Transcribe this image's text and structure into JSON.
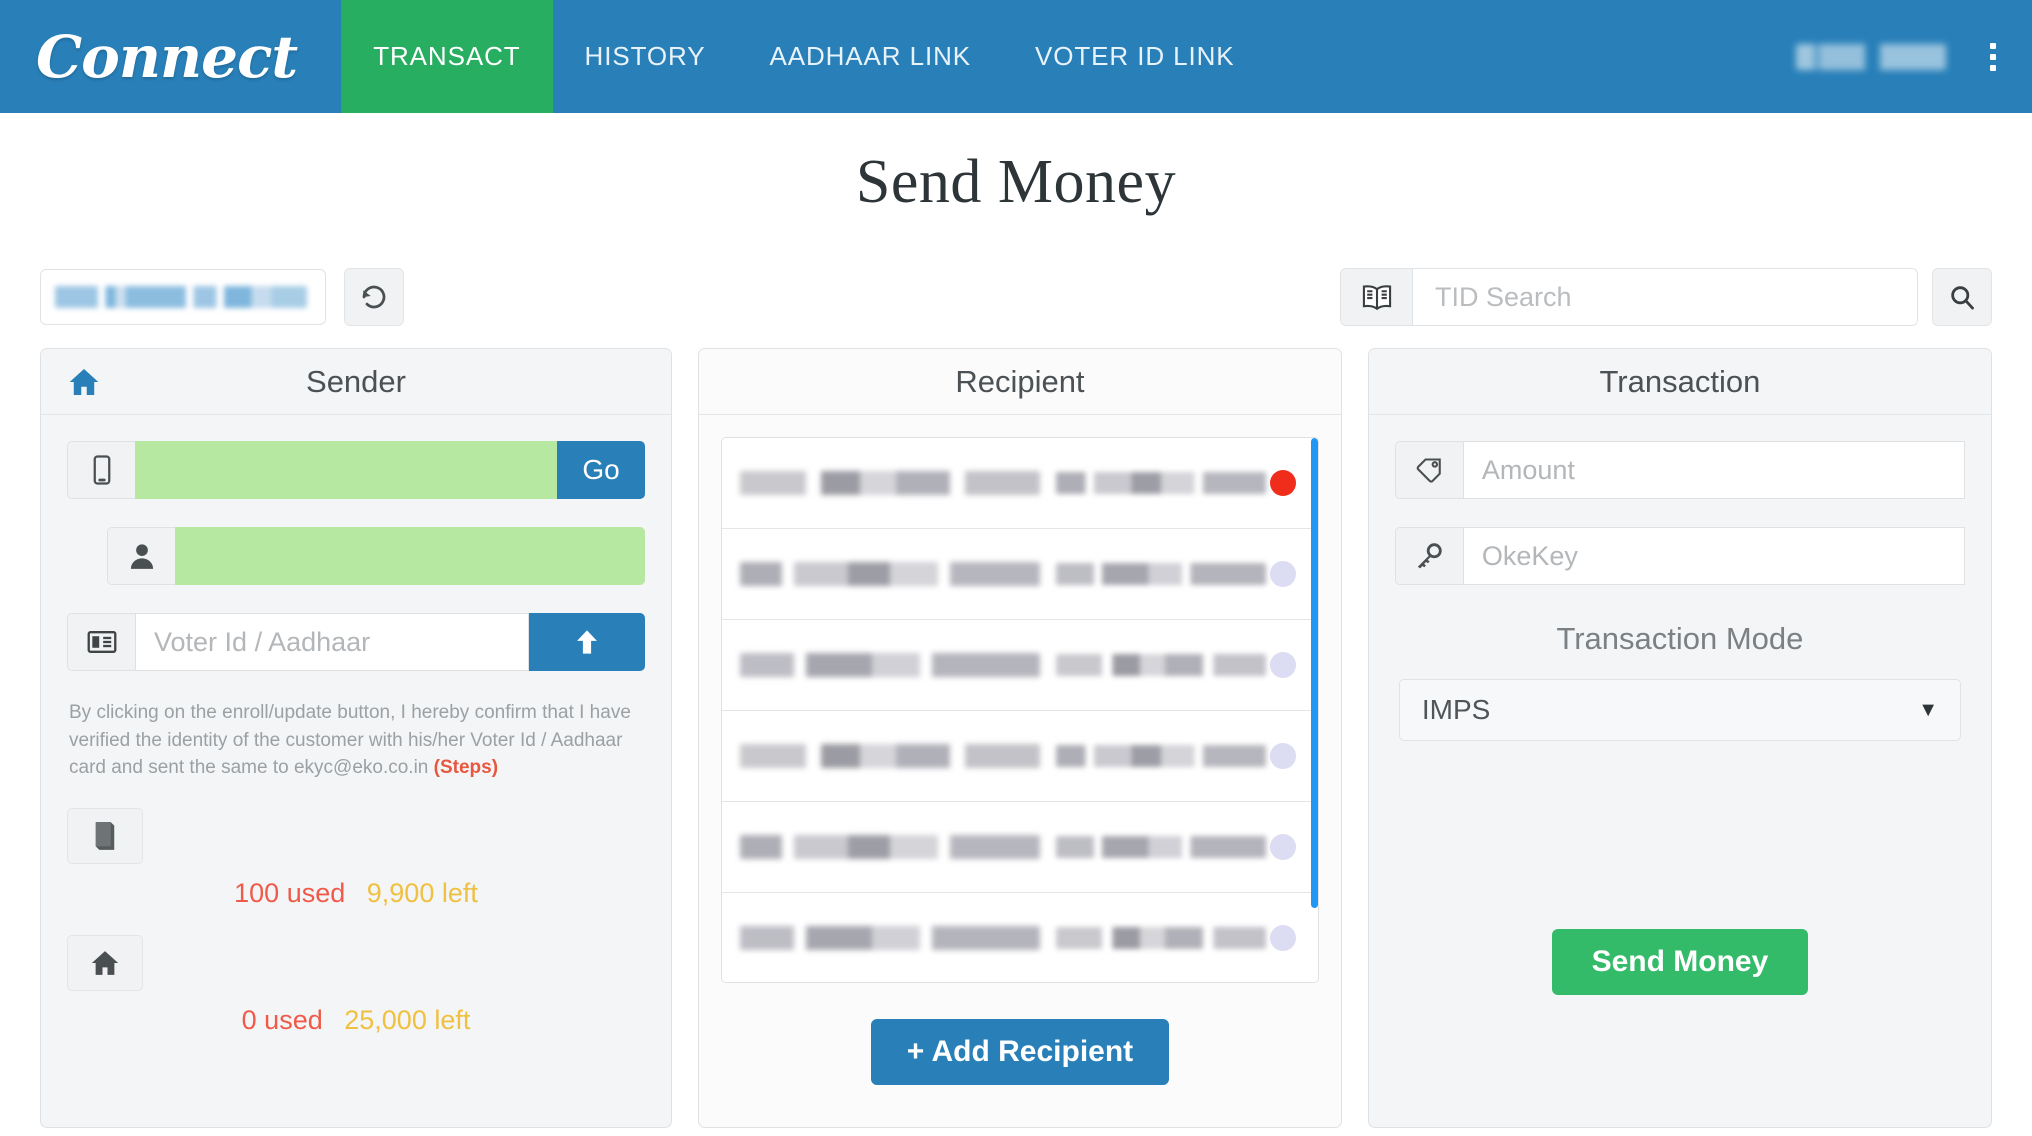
{
  "navbar": {
    "brand": "Connect",
    "tabs": [
      {
        "label": "TRANSACT",
        "active": true
      },
      {
        "label": "HISTORY",
        "active": false
      },
      {
        "label": "AADHAAR LINK",
        "active": false
      },
      {
        "label": "VOTER ID LINK",
        "active": false
      }
    ],
    "user_redacted": "",
    "menu_icon": "kebab-menu-icon",
    "colors": {
      "bar": "#2980b9",
      "active_tab": "#27ae60"
    }
  },
  "page": {
    "title": "Send Money"
  },
  "toolbar": {
    "agent_field_redacted": "",
    "refresh_icon": "refresh-icon",
    "search": {
      "book_icon": "book-icon",
      "placeholder": "TID Search",
      "value": "",
      "search_icon": "search-icon"
    }
  },
  "sender": {
    "title": "Sender",
    "home_icon": "home-icon",
    "mobile": {
      "icon": "mobile-icon",
      "value_redacted": "",
      "go_label": "Go"
    },
    "name": {
      "icon": "person-icon",
      "value_redacted": ""
    },
    "voter": {
      "icon": "id-card-icon",
      "placeholder": "Voter Id / Aadhaar",
      "value": "",
      "upload_icon": "upload-arrow-icon"
    },
    "disclaimer": "By clicking on the enroll/update button, I hereby confirm that I have verified the identity of the customer with his/her Voter Id / Aadhaar card and sent the same to ekyc@eko.co.in",
    "disclaimer_link": "(Steps)",
    "limits": [
      {
        "icon": "book-icon",
        "used": "100 used",
        "left": "9,900 left"
      },
      {
        "icon": "home-icon",
        "used": "0 used",
        "left": "25,000 left"
      }
    ]
  },
  "recipient": {
    "title": "Recipient",
    "rows": [
      {
        "name_redacted": "",
        "account_redacted": "",
        "status": "active"
      },
      {
        "name_redacted": "",
        "account_redacted": "",
        "status": "inactive"
      },
      {
        "name_redacted": "",
        "account_redacted": "",
        "status": "inactive"
      },
      {
        "name_redacted": "",
        "account_redacted": "",
        "status": "inactive"
      },
      {
        "name_redacted": "",
        "account_redacted": "",
        "status": "inactive"
      },
      {
        "name_redacted": "",
        "account_redacted": "",
        "status": "inactive"
      }
    ],
    "add_label": "+ Add Recipient"
  },
  "transaction": {
    "title": "Transaction",
    "amount": {
      "icon": "tag-icon",
      "placeholder": "Amount",
      "value": ""
    },
    "okekey": {
      "icon": "key-icon",
      "placeholder": "OkeKey",
      "value": ""
    },
    "mode_label": "Transaction Mode",
    "mode_value": "IMPS",
    "mode_caret": "▼",
    "send_label": "Send Money"
  }
}
